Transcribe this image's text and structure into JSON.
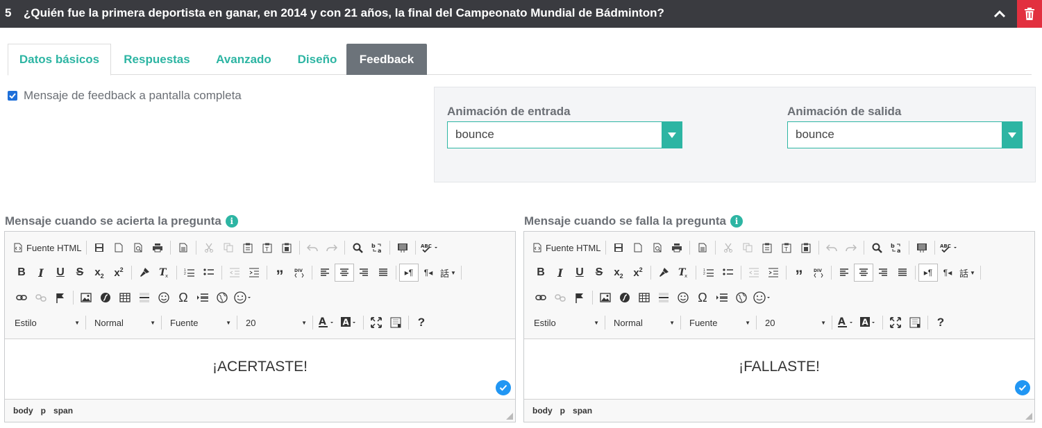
{
  "question": {
    "number": "5",
    "title": "¿Quién fue la primera deportista en ganar, en 2014 y con 21 años, la final del Campeonato Mundial de Bádminton?",
    "collapse_icon": "chevron-up-icon",
    "delete_icon": "trash-icon",
    "delete_color": "#e2303f"
  },
  "tabs": [
    {
      "label": "Datos básicos"
    },
    {
      "label": "Respuestas"
    },
    {
      "label": "Avanzado"
    },
    {
      "label": "Diseño"
    },
    {
      "label": "Feedback"
    }
  ],
  "selected_tab": "Feedback",
  "fullscreen_option": {
    "label": "Mensaje de feedback a pantalla completa",
    "checked": true
  },
  "animations": {
    "entry_label": "Animación de entrada",
    "entry_value": "bounce",
    "exit_label": "Animación de salida",
    "exit_value": "bounce"
  },
  "editors": {
    "correct": {
      "label": "Mensaje cuando se acierta la pregunta",
      "content": "¡ACERTASTE!"
    },
    "wrong": {
      "label": "Mensaje cuando se falla la pregunta",
      "content": "¡FALLASTE!"
    },
    "toolbar": {
      "source_label": "Fuente HTML",
      "style_combo": "Estilo",
      "format_combo": "Normal",
      "font_combo": "Fuente",
      "size_combo": "20",
      "info_glyph": "i"
    },
    "path": [
      "body",
      "p",
      "span"
    ]
  },
  "colors": {
    "accent": "#2db5a3",
    "header_bg": "#3a3b40",
    "selected_tab_bg": "#6c737a",
    "checkbox": "#1e6fd9",
    "ok_badge": "#2196f3"
  }
}
